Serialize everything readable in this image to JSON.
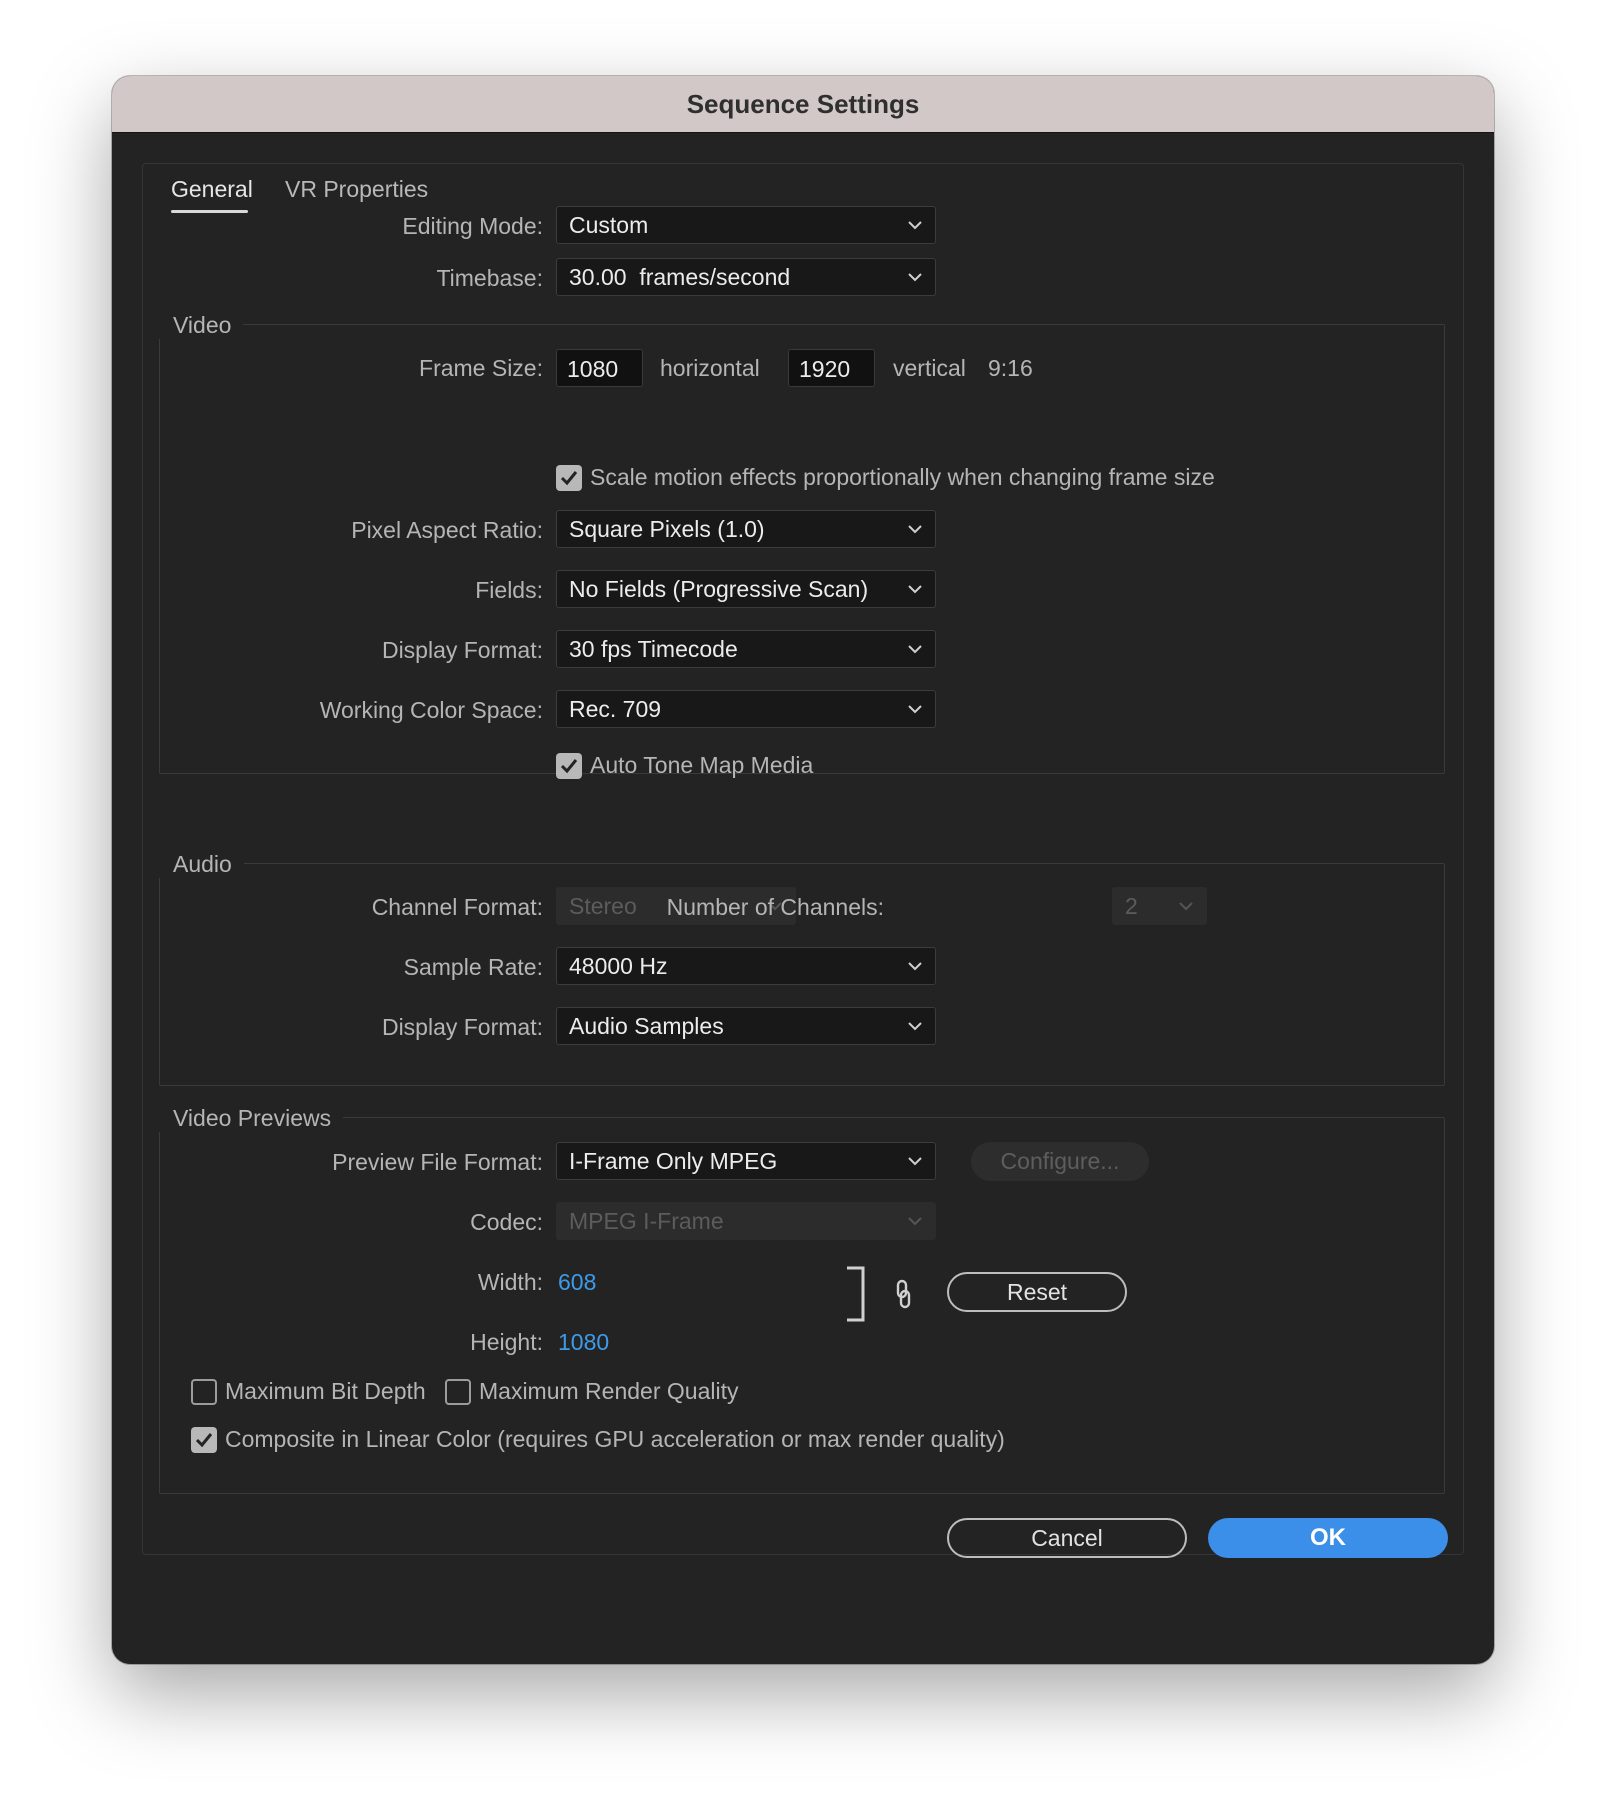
{
  "window": {
    "title": "Sequence Settings"
  },
  "tabs": [
    {
      "label": "General",
      "active": true
    },
    {
      "label": "VR Properties",
      "active": false
    }
  ],
  "general": {
    "editing_mode": {
      "label": "Editing Mode:",
      "value": "Custom"
    },
    "timebase": {
      "label": "Timebase:",
      "value": "30.00  frames/second"
    }
  },
  "video": {
    "group_title": "Video",
    "frame_size": {
      "label": "Frame Size:",
      "horizontal_value": "1080",
      "horizontal_label": "horizontal",
      "vertical_value": "1920",
      "vertical_label": "vertical",
      "aspect": "9:16"
    },
    "scale_motion": {
      "label": "Scale motion effects proportionally when changing frame size",
      "checked": true
    },
    "pixel_aspect_ratio": {
      "label": "Pixel Aspect Ratio:",
      "value": "Square Pixels (1.0)"
    },
    "fields": {
      "label": "Fields:",
      "value": "No Fields (Progressive Scan)"
    },
    "display_format": {
      "label": "Display Format:",
      "value": "30 fps Timecode"
    },
    "working_color_space": {
      "label": "Working Color Space:",
      "value": "Rec. 709"
    },
    "auto_tone_map": {
      "label": "Auto Tone Map Media",
      "checked": true
    }
  },
  "audio": {
    "group_title": "Audio",
    "channel_format": {
      "label": "Channel Format:",
      "value": "Stereo",
      "disabled": true
    },
    "number_of_channels": {
      "label": "Number of Channels:",
      "value": "2",
      "disabled": true
    },
    "sample_rate": {
      "label": "Sample Rate:",
      "value": "48000 Hz"
    },
    "display_format": {
      "label": "Display Format:",
      "value": "Audio Samples"
    }
  },
  "video_previews": {
    "group_title": "Video Previews",
    "preview_file_format": {
      "label": "Preview File Format:",
      "value": "I-Frame Only MPEG"
    },
    "configure_label": "Configure...",
    "codec": {
      "label": "Codec:",
      "value": "MPEG I-Frame",
      "disabled": true
    },
    "width": {
      "label": "Width:",
      "value": "608"
    },
    "height": {
      "label": "Height:",
      "value": "1080"
    },
    "link_icon": "link-icon",
    "reset_label": "Reset",
    "max_bit_depth": {
      "label": "Maximum Bit Depth",
      "checked": false
    },
    "max_render_quality": {
      "label": "Maximum Render Quality",
      "checked": false
    },
    "composite_linear": {
      "label": "Composite in Linear Color (requires GPU acceleration or max render quality)",
      "checked": true
    }
  },
  "footer": {
    "cancel_label": "Cancel",
    "ok_label": "OK"
  },
  "colors": {
    "accent": "#3b8fe8",
    "link_value": "#3d9be9",
    "window_bg": "#232323",
    "titlebar_bg": "#d3c8c8"
  }
}
